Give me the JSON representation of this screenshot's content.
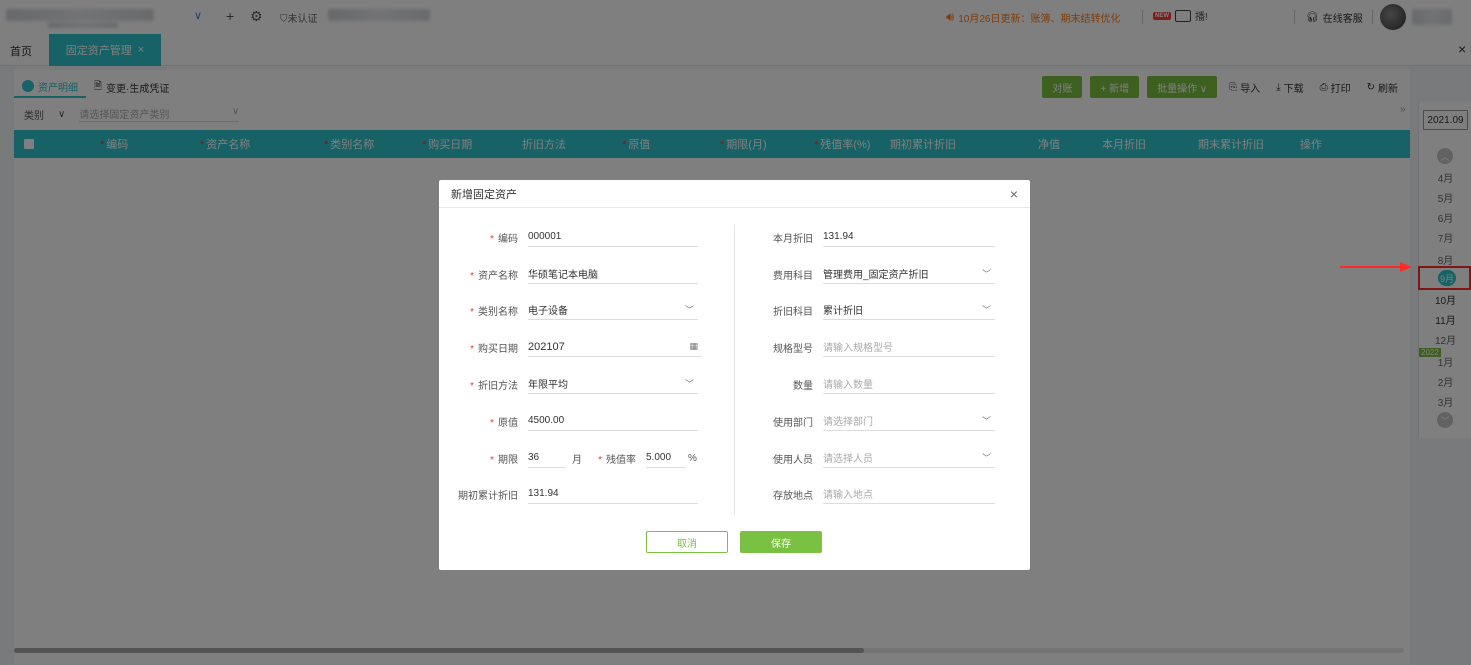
{
  "topbar": {
    "cert_status": "未认证",
    "notice": "10月26日更新：账簿、期末结转优化",
    "new_badge": "NEW",
    "new_text": "播!",
    "service": "在线客服"
  },
  "tabs": {
    "home": "首页",
    "active": "固定资产管理",
    "active_close": "×",
    "close_all": "×"
  },
  "subtabs": [
    {
      "label": "资产明细"
    },
    {
      "label": "变更·生成凭证"
    }
  ],
  "toolbar": {
    "reconcile": "对账",
    "add": "+ 新增",
    "batch": "批量操作 ∨",
    "import": "导入",
    "download": "下载",
    "print": "打印",
    "refresh": "刷新"
  },
  "filter": {
    "category_label": "类别",
    "category_placeholder": "请选择固定资产类别"
  },
  "table": {
    "columns": [
      "编码",
      "资产名称",
      "类别名称",
      "购买日期",
      "折旧方法",
      "原值",
      "期限(月)",
      "残值率(%)",
      "期初累计折旧",
      "净值",
      "本月折旧",
      "期末累计折旧",
      "操作"
    ]
  },
  "sidebar": {
    "year_label": "2021.09",
    "months_before": [
      "4月",
      "5月",
      "6月",
      "7月",
      "8月"
    ],
    "selected_month": "9月",
    "months_after": [
      "10月",
      "11月",
      "12月"
    ],
    "year_badge": "2022",
    "months_next": [
      "1月",
      "2月",
      "3月"
    ]
  },
  "modal": {
    "title": "新增固定资产",
    "left": {
      "code_label": "编码",
      "code_value": "000001",
      "name_label": "资产名称",
      "name_value": "华硕笔记本电脑",
      "category_label": "类别名称",
      "category_value": "电子设备",
      "date_label": "购买日期",
      "date_value": "202107",
      "method_label": "折旧方法",
      "method_value": "年限平均",
      "original_label": "原值",
      "original_value": "4500.00",
      "term_label": "期限",
      "term_value": "36",
      "term_unit": "月",
      "residual_label": "残值率",
      "residual_value": "5.000",
      "residual_unit": "%",
      "init_dep_label": "期初累计折旧",
      "init_dep_value": "131.94"
    },
    "right": {
      "month_dep_label": "本月折旧",
      "month_dep_value": "131.94",
      "expense_label": "费用科目",
      "expense_value": "管理费用_固定资产折旧",
      "dep_account_label": "折旧科目",
      "dep_account_value": "累计折旧",
      "spec_label": "规格型号",
      "spec_placeholder": "请输入规格型号",
      "qty_label": "数量",
      "qty_placeholder": "请输入数量",
      "dept_label": "使用部门",
      "dept_placeholder": "请选择部门",
      "user_label": "使用人员",
      "user_placeholder": "请选择人员",
      "location_label": "存放地点",
      "location_placeholder": "请输入地点"
    },
    "cancel": "取消",
    "save": "保存"
  }
}
